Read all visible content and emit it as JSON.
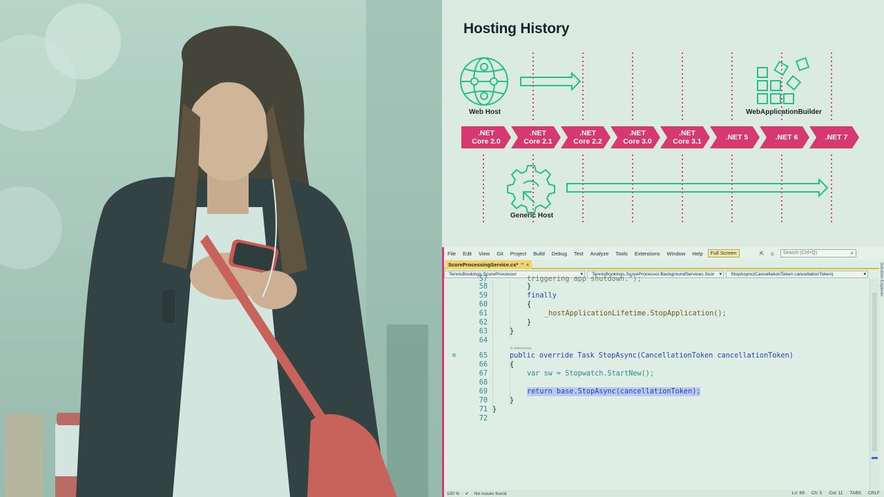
{
  "slide": {
    "title": "Hosting History",
    "web_host_label": "Web Host",
    "builder_label": "WebApplicationBuilder",
    "generic_host_label": "Generic Host",
    "versions": [
      {
        "line1": ".NET",
        "line2": "Core 2.0"
      },
      {
        "line1": ".NET",
        "line2": "Core 2.1"
      },
      {
        "line1": ".NET",
        "line2": "Core 2.2"
      },
      {
        "line1": ".NET",
        "line2": "Core 3.0"
      },
      {
        "line1": ".NET",
        "line2": "Core 3.1"
      },
      {
        "line1": ".NET 5",
        "line2": ""
      },
      {
        "line1": ".NET 6",
        "line2": ""
      },
      {
        "line1": ".NET 7",
        "line2": ""
      }
    ],
    "colors": {
      "accent": "#d5396f",
      "icon": "#1fc28a",
      "title": "#17252b"
    }
  },
  "ide": {
    "menu": [
      "File",
      "Edit",
      "View",
      "Git",
      "Project",
      "Build",
      "Debug",
      "Test",
      "Analyze",
      "Tools",
      "Extensions",
      "Window",
      "Help"
    ],
    "full_screen": "Full Screen",
    "search_placeholder": "Search (Ctrl+Q)",
    "file_tab": "ScoreProcessingService.cs*",
    "nav_project": "TennisBookings.ScoreProcessor",
    "nav_class": "TennisBookings.ScoreProcessor.BackgroundServices.Scor",
    "nav_member": "StopAsync(CancellationToken cancellationToken)",
    "solution_explorer": "Solution Explorer",
    "code_refs": "0 references",
    "lines": [
      {
        "n": "57",
        "text": "triggering app shutdown.\");"
      },
      {
        "n": "58",
        "text": "}"
      },
      {
        "n": "59",
        "text": "finally"
      },
      {
        "n": "60",
        "text": "{"
      },
      {
        "n": "61",
        "text": "_hostApplicationLifetime.StopApplication();"
      },
      {
        "n": "62",
        "text": "}"
      },
      {
        "n": "63",
        "text": "}"
      },
      {
        "n": "64",
        "text": ""
      },
      {
        "n": "65",
        "text": "public override Task StopAsync(CancellationToken cancellationToken)"
      },
      {
        "n": "66",
        "text": "{"
      },
      {
        "n": "67",
        "text": "var sw = Stopwatch.StartNew();"
      },
      {
        "n": "68",
        "text": ""
      },
      {
        "n": "69",
        "text": "return base.StopAsync(cancellationToken);"
      },
      {
        "n": "70",
        "text": "}"
      },
      {
        "n": "71",
        "text": "}"
      },
      {
        "n": "72",
        "text": ""
      }
    ],
    "status": {
      "zoom": "100 %",
      "issues": "No issues found",
      "ln": "Ln: 69",
      "ch": "Ch: 5",
      "col": "Col: 11",
      "tabs": "TABS",
      "eol": "CRLF"
    }
  }
}
